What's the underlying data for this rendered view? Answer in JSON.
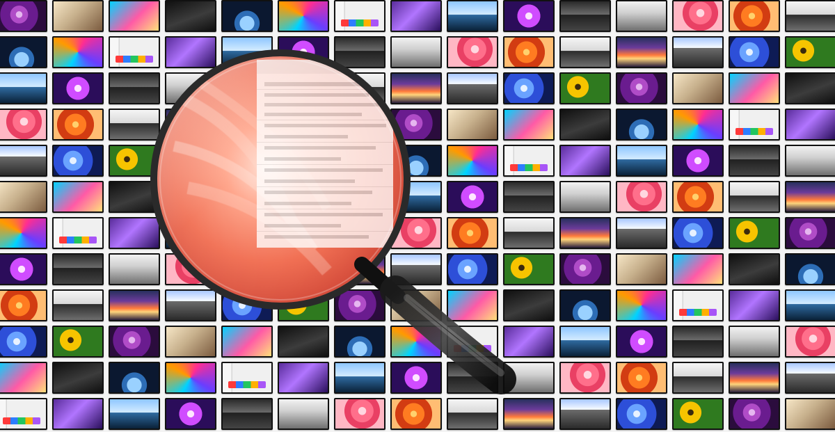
{
  "scene": {
    "wall": {
      "rows": 12,
      "cols": 15,
      "themes": [
        "t-purple",
        "t-pink",
        "t-spiral",
        "t-blueflower",
        "t-city",
        "t-dark",
        "t-sunset",
        "t-coast",
        "t-sand",
        "t-orange",
        "t-ui",
        "t-sunflower",
        "t-gray",
        "t-earth",
        "t-mountain",
        "t-neon",
        "t-tealpink",
        "t-road",
        "t-violet"
      ]
    },
    "magnifier": {
      "lens_content": "flower-macro",
      "overlay_panel": "spec-sheet"
    },
    "colors": {
      "background": "#f4f4f4",
      "lens_rim": "#2a2a2a",
      "handle": "#111111",
      "highlight": "#ffffff"
    }
  }
}
